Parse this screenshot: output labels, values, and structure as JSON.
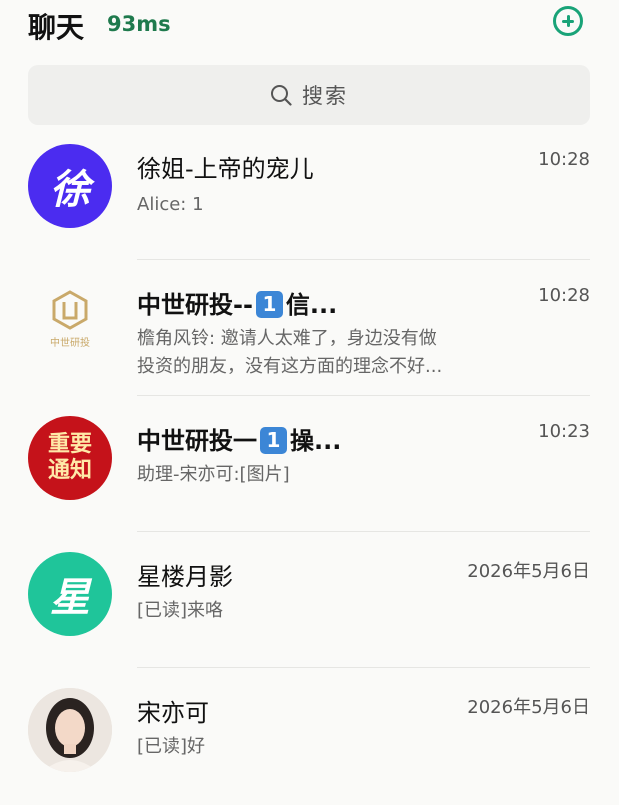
{
  "header": {
    "title": "聊天",
    "latency": "93ms",
    "add_icon": "plus-circle-icon",
    "accent_color": "#19a378"
  },
  "search": {
    "icon": "search-icon",
    "placeholder": "搜索"
  },
  "chats": [
    {
      "name": "徐姐-上帝的宠儿",
      "time": "10:28",
      "preview_line1": "Alice: 1",
      "preview_line2": "",
      "avatar_text": "徐",
      "avatar_color": "#4b2cf0"
    },
    {
      "name_prefix": "中世研投--",
      "badge": "1",
      "name_suffix": "信...",
      "time": "10:28",
      "preview_line1": "檐角风铃: 邀请人太难了，身边没有做",
      "preview_line2": "投资的朋友，没有这方面的理念不好...",
      "avatar_logo_text": "中世研投"
    },
    {
      "name_prefix": "中世研投一",
      "badge": "1",
      "name_suffix": "操...",
      "time": "10:23",
      "preview_line1": "助理-宋亦可:[图片]",
      "preview_line2": "",
      "avatar_text_line1": "重要",
      "avatar_text_line2": "通知",
      "avatar_color": "#c5121a"
    },
    {
      "name": "星楼月影",
      "time": "2026年5月6日",
      "preview_line1": "[已读]来咯",
      "preview_line2": "",
      "avatar_text": "星",
      "avatar_color": "#1fc59a"
    },
    {
      "name": "宋亦可",
      "time": "2026年5月6日",
      "preview_line1": "[已读]好",
      "preview_line2": "",
      "avatar_type": "photo"
    }
  ]
}
